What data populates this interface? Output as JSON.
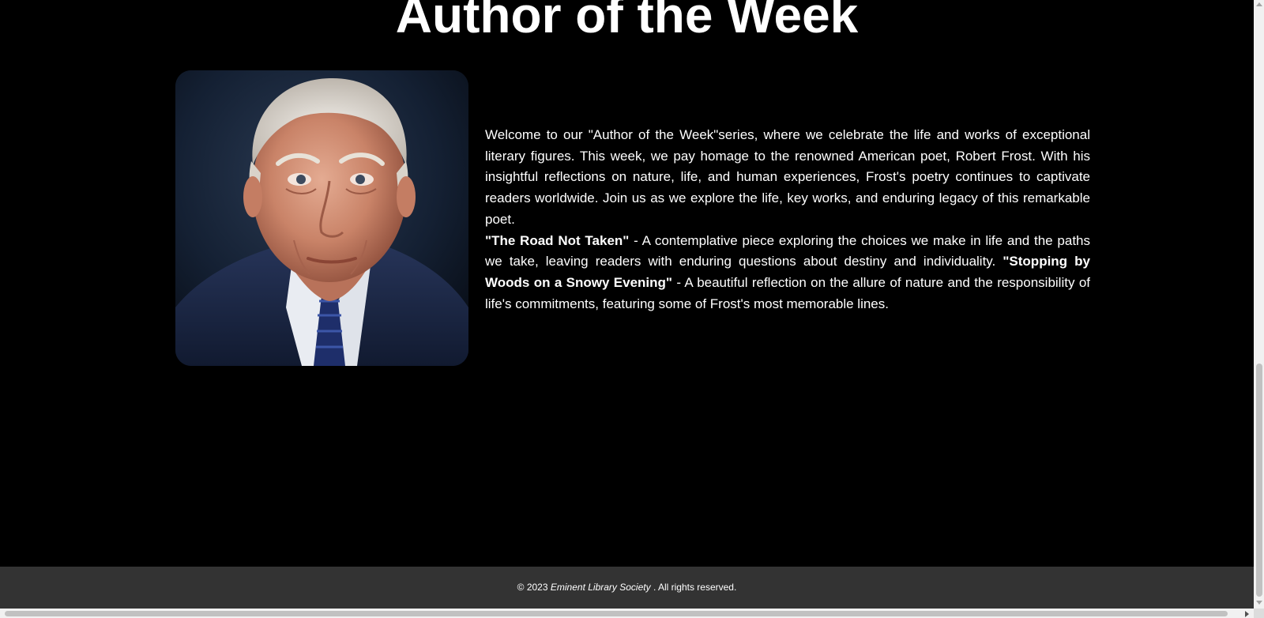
{
  "page": {
    "title": "Author of the Week"
  },
  "portrait": {
    "alt": "Robert Frost portrait"
  },
  "intro": {
    "text": "Welcome to our \"Author of the Week\"series, where we celebrate the life and works of exceptional literary figures. This week, we pay homage to the renowned American poet, Robert Frost. With his insightful reflections on nature, life, and human experiences, Frost's poetry continues to captivate readers worldwide. Join us as we explore the life, key works, and enduring legacy of this remarkable poet."
  },
  "works": [
    {
      "title": "\"The Road Not Taken\"",
      "description": " - A contemplative piece exploring the choices we make in life and the paths we take, leaving readers with enduring questions about destiny and individuality. "
    },
    {
      "title": "\"Stopping by Woods on a Snowy Evening\"",
      "description": " - A beautiful reflection on the allure of nature and the responsibility of life's commitments, featuring some of Frost's most memorable lines."
    }
  ],
  "footer": {
    "copyright": "© 2023 ",
    "organization": "Eminent Library Society",
    "rights": " . All rights reserved."
  },
  "colors": {
    "background": "#000000",
    "text": "#ffffff",
    "footer_bg": "#333333"
  }
}
